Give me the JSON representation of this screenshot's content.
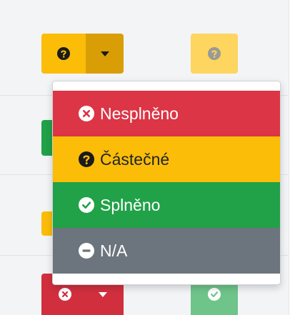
{
  "colors": {
    "danger": "#dc3545",
    "warning": "#fbbd08",
    "success": "#21a148",
    "secondary": "#6c757d"
  },
  "top_row": {
    "status_button": {
      "icon": "question-circle-icon",
      "toggle_icon": "caret-down-icon"
    },
    "status_badge": {
      "icon": "question-circle-icon"
    }
  },
  "bottom_row": {
    "status_button": {
      "icon": "times-circle-icon",
      "toggle_icon": "caret-down-icon"
    },
    "status_badge": {
      "icon": "check-circle-icon"
    }
  },
  "dropdown": {
    "items": [
      {
        "label": "Nesplněno",
        "icon": "times-circle-icon",
        "variant": "danger"
      },
      {
        "label": "Částečné",
        "icon": "question-circle-icon",
        "variant": "warning"
      },
      {
        "label": "Splněno",
        "icon": "check-circle-icon",
        "variant": "success"
      },
      {
        "label": "N/A",
        "icon": "minus-circle-icon",
        "variant": "secondary"
      }
    ]
  }
}
